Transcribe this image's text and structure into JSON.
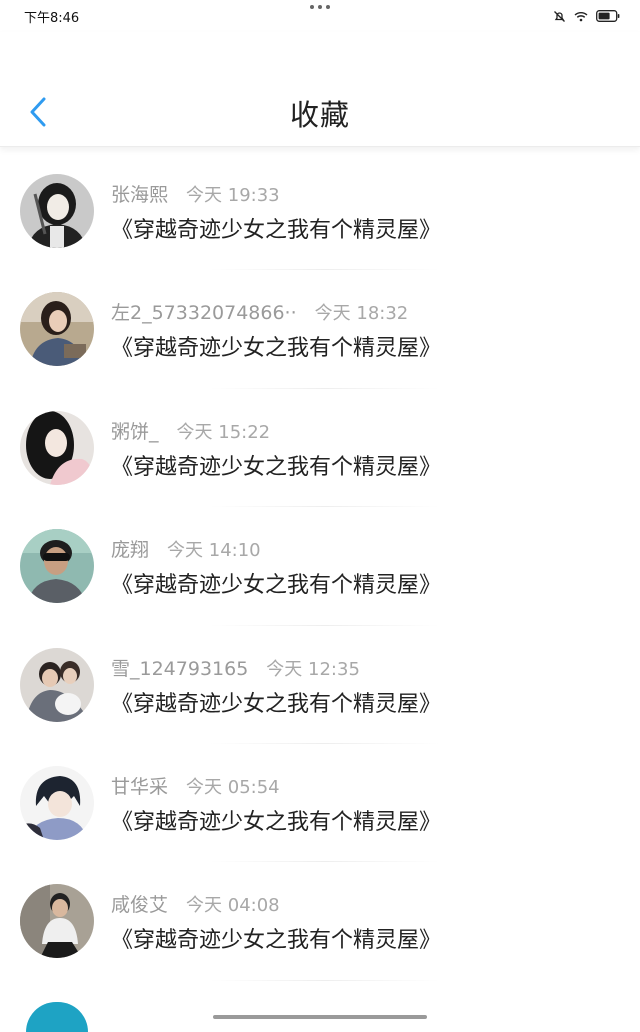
{
  "status": {
    "time": "下午8:46"
  },
  "header": {
    "title": "收藏"
  },
  "items": [
    {
      "name": "张海熙",
      "time": "今天 19:33",
      "title": "《穿越奇迹少女之我有个精灵屋》"
    },
    {
      "name": "左2_57332074866··",
      "time": "今天 18:32",
      "title": "《穿越奇迹少女之我有个精灵屋》"
    },
    {
      "name": "粥饼_",
      "time": "今天 15:22",
      "title": "《穿越奇迹少女之我有个精灵屋》"
    },
    {
      "name": "庞翔",
      "time": "今天 14:10",
      "title": "《穿越奇迹少女之我有个精灵屋》"
    },
    {
      "name": "雪_124793165",
      "time": "今天 12:35",
      "title": "《穿越奇迹少女之我有个精灵屋》"
    },
    {
      "name": "甘华采",
      "time": "今天 05:54",
      "title": "《穿越奇迹少女之我有个精灵屋》"
    },
    {
      "name": "咸俊艾",
      "time": "今天 04:08",
      "title": "《穿越奇迹少女之我有个精灵屋》"
    }
  ],
  "colors": {
    "accent": "#2f9bf0",
    "text_primary": "#222222",
    "text_secondary": "#9a9a9a"
  }
}
